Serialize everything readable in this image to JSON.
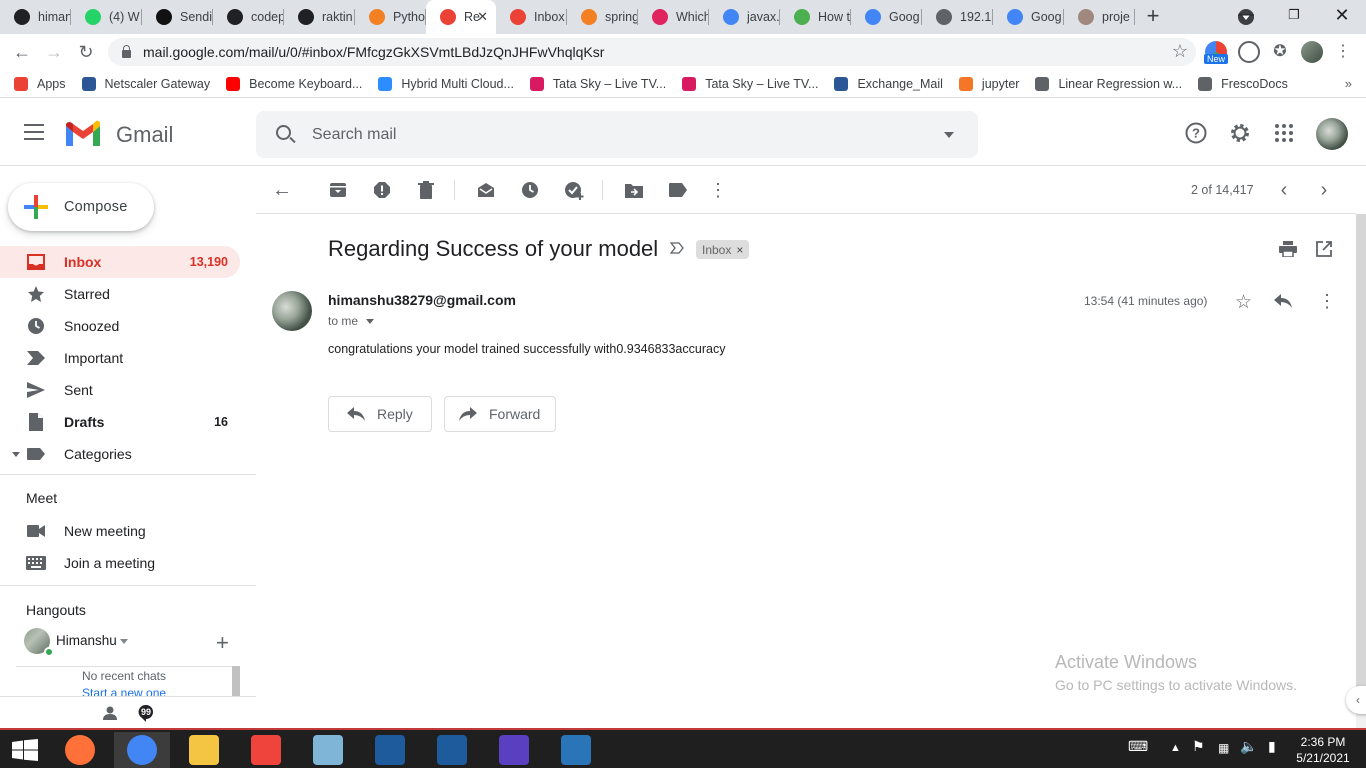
{
  "browser": {
    "tabs": [
      {
        "label": "himan",
        "icon": "github-icon",
        "color": "#202124"
      },
      {
        "label": "(4) W",
        "icon": "whatsapp-icon",
        "color": "#25d366"
      },
      {
        "label": "Sendi",
        "icon": "sendinblue-icon",
        "color": "#111111"
      },
      {
        "label": "codep",
        "icon": "github-icon",
        "color": "#202124"
      },
      {
        "label": "raktin",
        "icon": "github-icon",
        "color": "#202124"
      },
      {
        "label": "Pytho",
        "icon": "stackoverflow-icon",
        "color": "#f48024"
      },
      {
        "label": "Re",
        "icon": "gmail-icon",
        "color": "#ea4335",
        "active": true
      },
      {
        "label": "Inbox",
        "icon": "gmail-icon",
        "color": "#ea4335"
      },
      {
        "label": "spring",
        "icon": "stackoverflow-icon",
        "color": "#f48024"
      },
      {
        "label": "Which",
        "icon": "target-icon",
        "color": "#e0245e"
      },
      {
        "label": "javax.",
        "icon": "google-icon",
        "color": "#4285f4"
      },
      {
        "label": "How t",
        "icon": "csdn-icon",
        "color": "#4caf50"
      },
      {
        "label": "Goog",
        "icon": "google-icon",
        "color": "#4285f4"
      },
      {
        "label": "192.1",
        "icon": "globe-icon",
        "color": "#5f6368"
      },
      {
        "label": "Goog",
        "icon": "google-icon",
        "color": "#4285f4"
      },
      {
        "label": "proje",
        "icon": "avatar-icon",
        "color": "#a1887f"
      }
    ],
    "url": "mail.google.com/mail/u/0/#inbox/FMfcgzGkXSVmtLBdJzQnJHFwVhqlqKsr",
    "ext_badge": "New",
    "bookmarks": [
      {
        "label": "Apps",
        "icon": "apps-grid-icon",
        "color": "#ea4335"
      },
      {
        "label": "Netscaler Gateway",
        "icon": "tata-icon",
        "color": "#2b5797"
      },
      {
        "label": "Become Keyboard...",
        "icon": "youtube-icon",
        "color": "#ff0000"
      },
      {
        "label": "Hybrid Multi Cloud...",
        "icon": "zoom-icon",
        "color": "#2d8cff"
      },
      {
        "label": "Tata Sky – Live TV...",
        "icon": "tatasky-icon",
        "color": "#d81b60"
      },
      {
        "label": "Tata Sky – Live TV...",
        "icon": "tatasky-icon",
        "color": "#d81b60"
      },
      {
        "label": "Exchange_Mail",
        "icon": "tata-icon",
        "color": "#2b5797"
      },
      {
        "label": "jupyter",
        "icon": "jupyter-icon",
        "color": "#f37726"
      },
      {
        "label": "Linear Regression w...",
        "icon": "globe-icon",
        "color": "#5f6368"
      },
      {
        "label": "FrescoDocs",
        "icon": "globe-icon",
        "color": "#5f6368"
      }
    ]
  },
  "gmail": {
    "brand": "Gmail",
    "search_placeholder": "Search mail",
    "compose_label": "Compose",
    "nav": [
      {
        "label": "Inbox",
        "count": "13,190",
        "icon": "inbox-icon",
        "active": true
      },
      {
        "label": "Starred",
        "count": "",
        "icon": "star-icon"
      },
      {
        "label": "Snoozed",
        "count": "",
        "icon": "clock-icon"
      },
      {
        "label": "Important",
        "count": "",
        "icon": "important-icon"
      },
      {
        "label": "Sent",
        "count": "",
        "icon": "send-icon"
      },
      {
        "label": "Drafts",
        "count": "16",
        "icon": "draft-icon",
        "bold": true
      },
      {
        "label": "Categories",
        "count": "",
        "icon": "label-icon"
      }
    ],
    "meet": {
      "heading": "Meet",
      "items": [
        {
          "label": "New meeting",
          "icon": "video-icon"
        },
        {
          "label": "Join a meeting",
          "icon": "keyboard-icon"
        }
      ]
    },
    "hangouts": {
      "heading": "Hangouts",
      "user": "Himanshu",
      "no_chats": "No recent chats",
      "start_new": "Start a new one"
    },
    "toolbar": {
      "page_count": "2 of 14,417"
    },
    "message": {
      "subject": "Regarding Success of your model",
      "label": "Inbox",
      "sender": "himanshu38279@gmail.com",
      "to": "to me",
      "time": "13:54 (41 minutes ago)",
      "body": "congratulations your model trained successfully with0.9346833accuracy",
      "reply_label": "Reply",
      "forward_label": "Forward"
    },
    "watermark": {
      "line1": "Activate Windows",
      "line2": "Go to PC settings to activate Windows."
    }
  },
  "taskbar": {
    "time": "2:36 PM",
    "date": "5/21/2021",
    "apps": [
      {
        "name": "firefox-icon",
        "color": "#ff7139"
      },
      {
        "name": "chrome-icon",
        "color": "#4285f4",
        "open": true
      },
      {
        "name": "file-explorer-icon",
        "color": "#f4c542"
      },
      {
        "name": "anydesk-icon",
        "color": "#ef443b"
      },
      {
        "name": "notepad-icon",
        "color": "#7fb5d6"
      },
      {
        "name": "virtualbox-icon",
        "color": "#1e5b9c"
      },
      {
        "name": "virtualbox-icon",
        "color": "#1e5b9c"
      },
      {
        "name": "settings-icon",
        "color": "#5a3fc0"
      },
      {
        "name": "photos-icon",
        "color": "#2a74b8"
      }
    ]
  }
}
